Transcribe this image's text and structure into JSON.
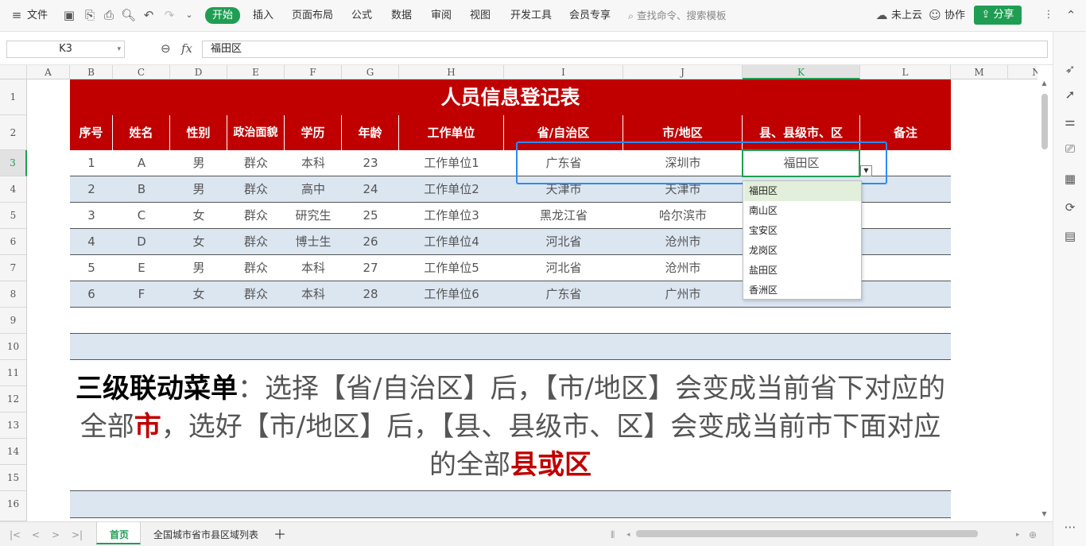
{
  "menu": {
    "file": "文件",
    "tabs": [
      "开始",
      "插入",
      "页面布局",
      "公式",
      "数据",
      "审阅",
      "视图",
      "开发工具",
      "会员专享"
    ],
    "search_placeholder": "查找命令、搜索模板",
    "cloud": "未上云",
    "collab": "协作",
    "share": "分享"
  },
  "formula_bar": {
    "cell_ref": "K3",
    "fx": "fx",
    "value": "福田区"
  },
  "columns": [
    "A",
    "B",
    "C",
    "D",
    "E",
    "F",
    "G",
    "H",
    "I",
    "J",
    "K",
    "L",
    "M",
    "N"
  ],
  "rows": [
    "1",
    "2",
    "3",
    "4",
    "5",
    "6",
    "7",
    "8",
    "9",
    "10",
    "11",
    "12",
    "13",
    "14",
    "15",
    "16"
  ],
  "table": {
    "title": "人员信息登记表",
    "headers": [
      "序号",
      "姓名",
      "性别",
      "政治面貌",
      "学历",
      "年龄",
      "工作单位",
      "省/自治区",
      "市/地区",
      "县、县级市、区",
      "备注"
    ],
    "data": [
      [
        "1",
        "A",
        "男",
        "群众",
        "本科",
        "23",
        "工作单位1",
        "广东省",
        "深圳市",
        "福田区",
        ""
      ],
      [
        "2",
        "B",
        "男",
        "群众",
        "高中",
        "24",
        "工作单位2",
        "天津市",
        "天津市",
        "",
        ""
      ],
      [
        "3",
        "C",
        "女",
        "群众",
        "研究生",
        "25",
        "工作单位3",
        "黑龙江省",
        "哈尔滨市",
        "",
        ""
      ],
      [
        "4",
        "D",
        "女",
        "群众",
        "博士生",
        "26",
        "工作单位4",
        "河北省",
        "沧州市",
        "",
        ""
      ],
      [
        "5",
        "E",
        "男",
        "群众",
        "本科",
        "27",
        "工作单位5",
        "河北省",
        "沧州市",
        "",
        ""
      ],
      [
        "6",
        "F",
        "女",
        "群众",
        "本科",
        "28",
        "工作单位6",
        "广东省",
        "广州市",
        "",
        ""
      ]
    ]
  },
  "dropdown": {
    "options": [
      "福田区",
      "南山区",
      "宝安区",
      "龙岗区",
      "盐田区",
      "香洲区"
    ],
    "selected": "福田区"
  },
  "description": {
    "p1": "三级联动菜单",
    "p2": "：选择【省/自治区】后，【市/地区】会变成当前省下对应的全部",
    "p3": "市",
    "p4": "，选好【市/地区】后，【县、县级市、区】会变成当前市下面对应的全部",
    "p5": "县或区"
  },
  "sheets": {
    "tabs": [
      "首页",
      "全国城市省市县区域列表"
    ],
    "active": "首页"
  },
  "colors": {
    "brand_green": "#1f9e53",
    "header_red": "#c00000",
    "band_blue": "#dce6f1"
  }
}
